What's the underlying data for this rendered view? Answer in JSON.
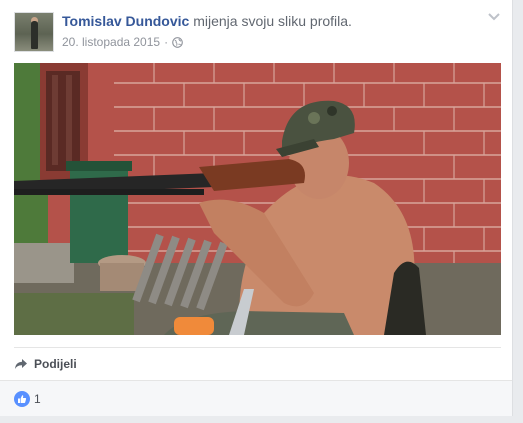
{
  "post": {
    "author": "Tomislav Dundovic",
    "action": " mijenja svoju sliku profila.",
    "date": "20. listopada 2015",
    "separator": "·",
    "privacy_icon": "globe-icon",
    "options_icon": "chevron-down-icon",
    "photo_description_icon": "profile-photo"
  },
  "actions": {
    "share_label": "Podijeli",
    "share_icon": "share-arrow-icon"
  },
  "reactions": {
    "icon": "like-thumb-icon",
    "count": "1"
  },
  "colors": {
    "link": "#365899",
    "meta": "#90949c",
    "like_blue": "#5890ff",
    "page_bg": "#e9ebee"
  }
}
